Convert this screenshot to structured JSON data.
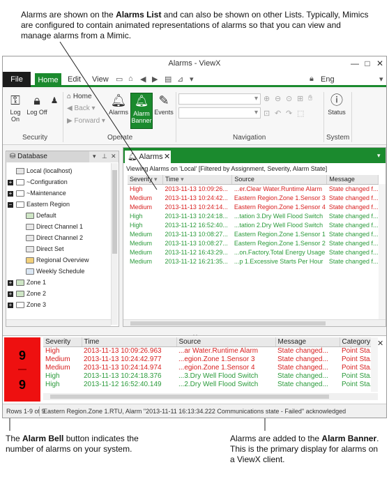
{
  "annotations": {
    "top": {
      "pre": "Alarms are shown on the ",
      "bold": "Alarms List",
      "post": " and can also be shown on other Lists. Typically, Mimics are configured to contain animated representations of alarms so that you can view and manage alarms from a Mimic."
    },
    "bottom_left": {
      "pre": "The ",
      "bold": "Alarm Bell",
      "post": " button indicates the number of alarms on your system."
    },
    "bottom_right": {
      "pre": "Alarms are added to the ",
      "bold": "Alarm Banner",
      "post": ". This is the primary display for alarms on a ViewX client."
    }
  },
  "window": {
    "title": "Alarms - ViewX",
    "controls": {
      "minimize": "—",
      "maximize": "□",
      "close": "✕"
    }
  },
  "menubar": {
    "file": "File",
    "home": "Home",
    "edit": "Edit",
    "view": "View",
    "language": "Eng"
  },
  "ribbon": {
    "security": {
      "label": "Security",
      "log_on": "Log On",
      "log_off": "Log Off"
    },
    "operate": {
      "label": "Operate",
      "home": "Home",
      "back": "Back",
      "forward": "Forward",
      "alarms": "Alarms",
      "alarm_banner": "Alarm Banner",
      "events": "Events"
    },
    "navigation": {
      "label": "Navigation"
    },
    "system": {
      "label": "System",
      "status": "Status"
    }
  },
  "database_pane": {
    "tab_label": "Database",
    "tree": [
      {
        "label": "Local (localhost)",
        "icon": "pc-icon",
        "depth": 0,
        "expander": ""
      },
      {
        "label": "~Configuration",
        "icon": "folder-icon",
        "depth": 0,
        "expander": "+"
      },
      {
        "label": "~Maintenance",
        "icon": "folder-icon",
        "depth": 0,
        "expander": "+"
      },
      {
        "label": "Eastern Region",
        "icon": "folder-icon",
        "depth": 0,
        "expander": "−"
      },
      {
        "label": "Default",
        "icon": "mimic-icon",
        "depth": 1,
        "expander": ""
      },
      {
        "label": "Direct Channel 1",
        "icon": "list-icon",
        "depth": 1,
        "expander": ""
      },
      {
        "label": "Direct Channel 2",
        "icon": "list-icon",
        "depth": 1,
        "expander": ""
      },
      {
        "label": "Direct Set",
        "icon": "list-icon",
        "depth": 1,
        "expander": ""
      },
      {
        "label": "Regional Overview",
        "icon": "chart-icon",
        "depth": 1,
        "expander": ""
      },
      {
        "label": "Weekly Schedule",
        "icon": "schedule-icon",
        "depth": 1,
        "expander": ""
      },
      {
        "label": "Zone 1",
        "icon": "mimic-folder-icon",
        "depth": 0,
        "expander": "+"
      },
      {
        "label": "Zone 2",
        "icon": "mimic-folder-icon",
        "depth": 0,
        "expander": "+"
      },
      {
        "label": "Zone 3",
        "icon": "folder-icon",
        "depth": 0,
        "expander": "+"
      }
    ]
  },
  "alarms_list": {
    "tab_label": "Alarms",
    "filter_text": "Viewing Alarms on 'Local' [Filtered by Assignment, Severity, Alarm State]",
    "columns": [
      "Severity",
      "Time",
      "Source",
      "Message"
    ],
    "rows": [
      {
        "severity": "High",
        "time": "2013-11-13 10:09:26...",
        "source": "...er.Clear Water.Runtime Alarm",
        "message": "State changed f...",
        "tone": "high-red"
      },
      {
        "severity": "Medium",
        "time": "2013-11-13 10:24:42...",
        "source": "Eastern Region.Zone 1.Sensor 3",
        "message": "State changed f...",
        "tone": "med"
      },
      {
        "severity": "Medium",
        "time": "2013-11-13 10:24:14...",
        "source": "Eastern Region.Zone 1.Sensor 4",
        "message": "State changed f...",
        "tone": "med"
      },
      {
        "severity": "High",
        "time": "2013-11-13 10:24:18...",
        "source": "...tation 3.Dry Well Flood Switch",
        "message": "State changed f...",
        "tone": "high"
      },
      {
        "severity": "High",
        "time": "2013-11-12 16:52:40...",
        "source": "...tation 2.Dry Well Flood Switch",
        "message": "State changed f...",
        "tone": "high"
      },
      {
        "severity": "Medium",
        "time": "2013-11-13 10:08:27...",
        "source": "Eastern Region.Zone 1.Sensor 1",
        "message": "State changed f...",
        "tone": "high"
      },
      {
        "severity": "Medium",
        "time": "2013-11-13 10:08:27...",
        "source": "Eastern Region.Zone 1.Sensor 2",
        "message": "State changed f...",
        "tone": "high"
      },
      {
        "severity": "Medium",
        "time": "2013-11-12 16:43:29...",
        "source": "...on.Factory.Total Energy Usage",
        "message": "State changed f...",
        "tone": "high"
      },
      {
        "severity": "Medium",
        "time": "2013-11-12 16:21:35...",
        "source": "...p 1.Excessive Starts Per Hour",
        "message": "State changed f...",
        "tone": "high"
      }
    ]
  },
  "alarm_bell": {
    "count_top": "9",
    "count_bottom": "9",
    "color": "#ee1010"
  },
  "alarm_banner": {
    "columns": [
      "Severity",
      "Time",
      "Source",
      "Message",
      "Category"
    ],
    "rows": [
      {
        "severity": "High",
        "time": "2013-11-13 10:09:26.963",
        "source": "...ar Water.Runtime Alarm",
        "message": "State  changed...",
        "category": "Point Sta...",
        "tone": "high-red"
      },
      {
        "severity": "Medium",
        "time": "2013-11-13 10:24:42.977",
        "source": "...egion.Zone 1.Sensor 3",
        "message": "State  changed...",
        "category": "Point Sta...",
        "tone": "med"
      },
      {
        "severity": "Medium",
        "time": "2013-11-13 10:24:14.974",
        "source": "...egion.Zone 1.Sensor 4",
        "message": "State  changed...",
        "category": "Point Sta...",
        "tone": "med"
      },
      {
        "severity": "High",
        "time": "2013-11-13 10:24:18.376",
        "source": "...3.Dry Well Flood Switch",
        "message": "State  changed...",
        "category": "Point Sta...",
        "tone": "high"
      },
      {
        "severity": "High",
        "time": "2013-11-12 16:52:40.149",
        "source": "...2.Dry Well Flood Switch",
        "message": "State  changed...",
        "category": "Point Sta...",
        "tone": "high"
      }
    ]
  },
  "statusbar": {
    "rows": "Rows 1-9 of 9",
    "message": "Eastern Region.Zone 1.RTU, Alarm \"2013-11-11 16:13:34.222 Communications state - Failed\" acknowledged"
  },
  "colors": {
    "accent": "#1b8a2e",
    "alarm_red": "#d81e1e",
    "alarm_green": "#2a9a3a",
    "file_tab": "#1c1c1c"
  }
}
